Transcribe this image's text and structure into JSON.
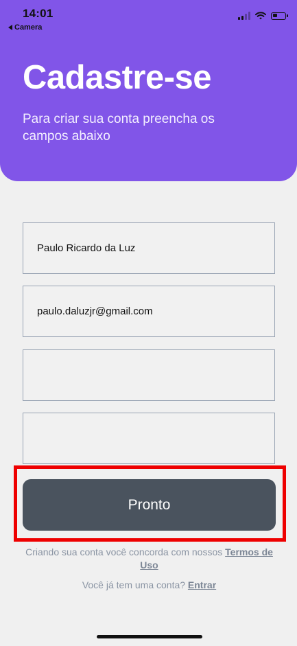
{
  "status_bar": {
    "time": "14:01",
    "back_label": "Camera",
    "icons": [
      "signal-icon",
      "wifi-icon",
      "battery-icon"
    ]
  },
  "header": {
    "title": "Cadastre-se",
    "subtitle": "Para criar sua conta preencha os campos abaixo"
  },
  "form": {
    "fields": [
      {
        "value": "Paulo Ricardo da Luz",
        "placeholder": ""
      },
      {
        "value": "paulo.daluzjr@gmail.com",
        "placeholder": ""
      },
      {
        "value": "",
        "placeholder": ""
      },
      {
        "value": "",
        "placeholder": ""
      }
    ],
    "submit_label": "Pronto"
  },
  "terms": {
    "prefix": "Criando sua conta você concorda com nossos",
    "link": "Termos de Uso"
  },
  "login": {
    "prefix": "Você já tem uma conta?",
    "link": "Entrar"
  },
  "colors": {
    "header_bg": "#8155e8",
    "button_bg": "#4a535e",
    "highlight": "#ee0000",
    "page_bg": "#f0f0f0"
  }
}
